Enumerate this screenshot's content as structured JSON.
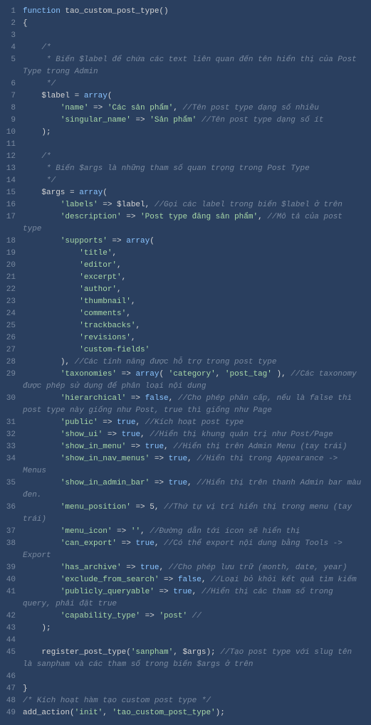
{
  "lines": [
    {
      "n": "1",
      "code": "function tao_custom_post_type()"
    },
    {
      "n": "2",
      "code": "{"
    },
    {
      "n": "3",
      "code": ""
    },
    {
      "n": "4",
      "code": "    /*"
    },
    {
      "n": "5",
      "code": "     * Biến $label để chứa các text liên quan đến tên hiển thị của Post Type trong Admin"
    },
    {
      "n": "6",
      "code": "     */"
    },
    {
      "n": "7",
      "code": "    $label = array("
    },
    {
      "n": "8",
      "code": "        'name' => 'Các sản phẩm', //Tên post type dạng số nhiều"
    },
    {
      "n": "9",
      "code": "        'singular_name' => 'Sản phẩm' //Tên post type dạng số ít"
    },
    {
      "n": "10",
      "code": "    );"
    },
    {
      "n": "11",
      "code": ""
    },
    {
      "n": "12",
      "code": "    /*"
    },
    {
      "n": "13",
      "code": "     * Biến $args là những tham số quan trọng trong Post Type"
    },
    {
      "n": "14",
      "code": "     */"
    },
    {
      "n": "15",
      "code": "    $args = array("
    },
    {
      "n": "16",
      "code": "        'labels' => $label, //Gọi các label trong biến $label ở trên"
    },
    {
      "n": "17",
      "code": "        'description' => 'Post type đăng sản phẩm', //Mô tả của post type"
    },
    {
      "n": "18",
      "code": "        'supports' => array("
    },
    {
      "n": "19",
      "code": "            'title',"
    },
    {
      "n": "20",
      "code": "            'editor',"
    },
    {
      "n": "21",
      "code": "            'excerpt',"
    },
    {
      "n": "22",
      "code": "            'author',"
    },
    {
      "n": "23",
      "code": "            'thumbnail',"
    },
    {
      "n": "24",
      "code": "            'comments',"
    },
    {
      "n": "25",
      "code": "            'trackbacks',"
    },
    {
      "n": "26",
      "code": "            'revisions',"
    },
    {
      "n": "27",
      "code": "            'custom-fields'"
    },
    {
      "n": "28",
      "code": "        ), //Các tính năng được hỗ trợ trong post type"
    },
    {
      "n": "29",
      "code": "        'taxonomies' => array( 'category', 'post_tag' ), //Các taxonomy được phép sử dụng để phân loại nội dung"
    },
    {
      "n": "30",
      "code": "        'hierarchical' => false, //Cho phép phân cấp, nếu là false thì post type này giống như Post, true thì giống như Page"
    },
    {
      "n": "31",
      "code": "        'public' => true, //Kích hoạt post type"
    },
    {
      "n": "32",
      "code": "        'show_ui' => true, //Hiển thị khung quản trị như Post/Page"
    },
    {
      "n": "33",
      "code": "        'show_in_menu' => true, //Hiển thị trên Admin Menu (tay trái)"
    },
    {
      "n": "34",
      "code": "        'show_in_nav_menus' => true, //Hiển thị trong Appearance -> Menus"
    },
    {
      "n": "35",
      "code": "        'show_in_admin_bar' => true, //Hiển thị trên thanh Admin bar màu đen."
    },
    {
      "n": "36",
      "code": "        'menu_position' => 5, //Thứ tự vị trí hiển thị trong menu (tay trái)"
    },
    {
      "n": "37",
      "code": "        'menu_icon' => '', //Đường dẫn tới icon sẽ hiển thị"
    },
    {
      "n": "38",
      "code": "        'can_export' => true, //Có thể export nội dung bằng Tools -> Export"
    },
    {
      "n": "39",
      "code": "        'has_archive' => true, //Cho phép lưu trữ (month, date, year)"
    },
    {
      "n": "40",
      "code": "        'exclude_from_search' => false, //Loại bỏ khỏi kết quả tìm kiếm"
    },
    {
      "n": "41",
      "code": "        'publicly_queryable' => true, //Hiển thị các tham số trong query, phải đặt true"
    },
    {
      "n": "42",
      "code": "        'capability_type' => 'post' //"
    },
    {
      "n": "43",
      "code": "    );"
    },
    {
      "n": "44",
      "code": ""
    },
    {
      "n": "45",
      "code": "    register_post_type('sanpham', $args); //Tạo post type với slug tên là sanpham và các tham số trong biến $args ở trên"
    },
    {
      "n": "46",
      "code": ""
    },
    {
      "n": "47",
      "code": "}"
    },
    {
      "n": "48",
      "code": "/* Kích hoạt hàm tạo custom post type */"
    },
    {
      "n": "49",
      "code": "add_action('init', 'tao_custom_post_type');"
    }
  ]
}
